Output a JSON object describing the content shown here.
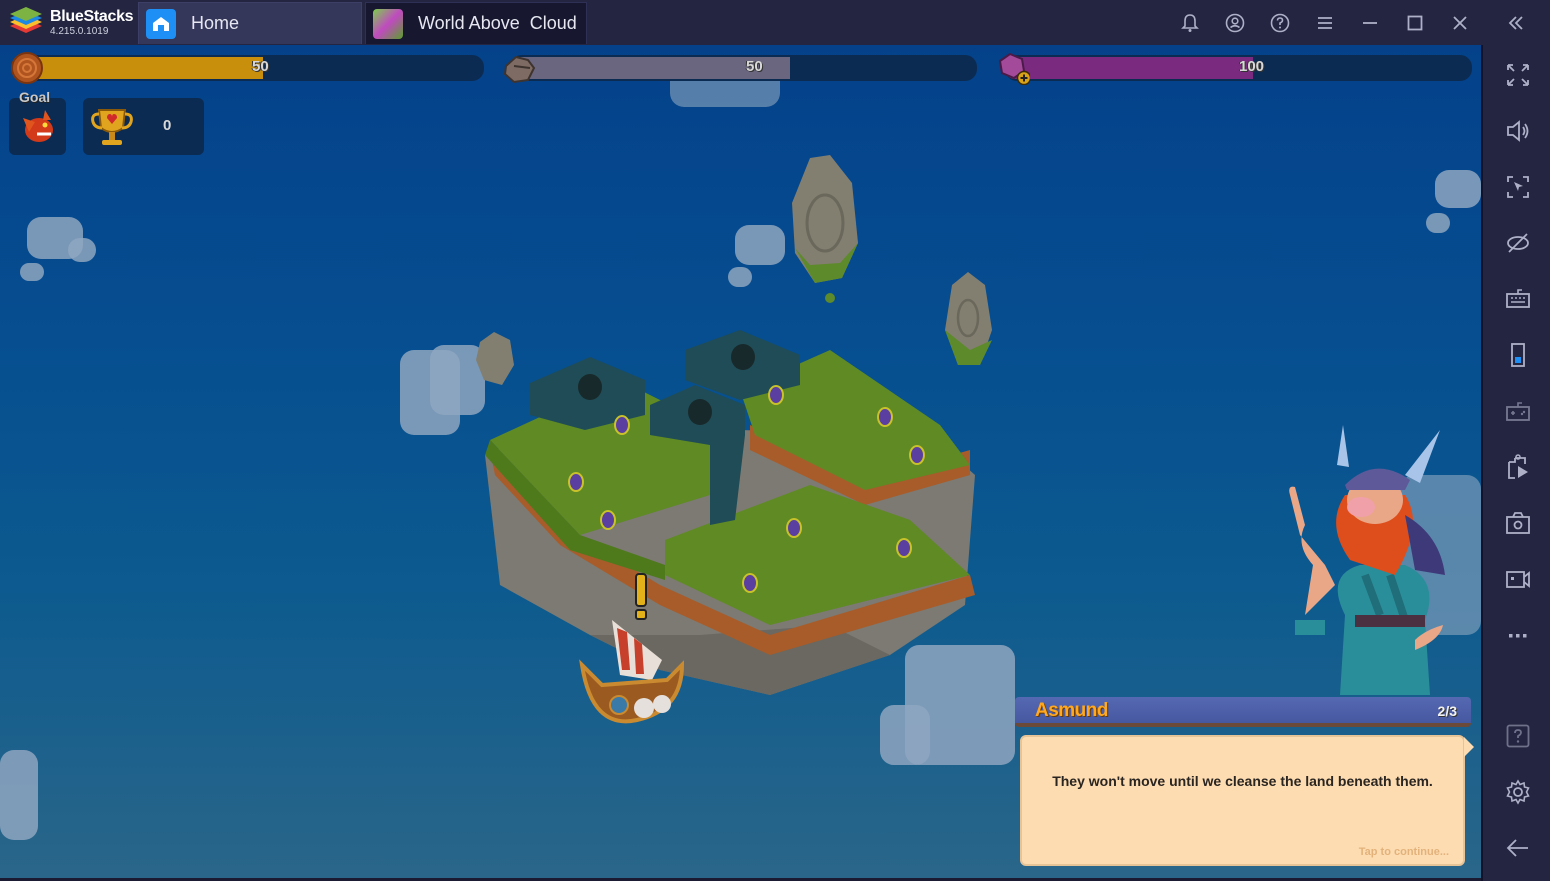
{
  "app": {
    "name": "BlueStacks",
    "version": "4.215.0.1019"
  },
  "tabs": [
    {
      "label": "Home",
      "icon": "home-icon",
      "active": false
    },
    {
      "label": "World Above  Cloud",
      "icon": "game-icon",
      "active": true
    }
  ],
  "titlebar_buttons": [
    {
      "name": "notifications",
      "icon": "bell-icon"
    },
    {
      "name": "account",
      "icon": "account-icon"
    },
    {
      "name": "help",
      "icon": "help-icon"
    },
    {
      "name": "menu",
      "icon": "hamburger-icon"
    },
    {
      "name": "minimize",
      "icon": "minimize-icon"
    },
    {
      "name": "maximize",
      "icon": "maximize-icon"
    },
    {
      "name": "close",
      "icon": "close-icon"
    },
    {
      "name": "collapse-sidebar",
      "icon": "double-chevron-left-icon"
    }
  ],
  "sidebar": [
    {
      "name": "fullscreen",
      "icon": "fullscreen-icon"
    },
    {
      "name": "volume",
      "icon": "volume-icon"
    },
    {
      "name": "lock-cursor",
      "icon": "cursor-lock-icon"
    },
    {
      "name": "hide-overlay",
      "icon": "eye-off-icon"
    },
    {
      "name": "keyboard-controls",
      "icon": "keyboard-icon"
    },
    {
      "name": "rotate",
      "icon": "phone-portrait-icon"
    },
    {
      "name": "gamepad",
      "icon": "gamepad-icon"
    },
    {
      "name": "install-apk",
      "icon": "apk-install-icon"
    },
    {
      "name": "screenshot",
      "icon": "camera-icon"
    },
    {
      "name": "record",
      "icon": "video-record-icon"
    },
    {
      "name": "more",
      "icon": "more-icon"
    },
    {
      "name": "help",
      "icon": "help-square-icon"
    },
    {
      "name": "settings",
      "icon": "gear-icon"
    },
    {
      "name": "back",
      "icon": "arrow-left-icon"
    }
  ],
  "game": {
    "resources": [
      {
        "name": "wood",
        "icon": "wood-icon",
        "value": "50",
        "fill_fraction": 0.53,
        "color": "#c78f0b"
      },
      {
        "name": "stone",
        "icon": "stone-icon",
        "value": "50",
        "fill_fraction": 0.6,
        "color": "#6b6680"
      },
      {
        "name": "gems",
        "icon": "gem-icon",
        "value": "100",
        "fill_fraction": 0.53,
        "color": "#7a2b80"
      }
    ],
    "goal_label": "Goal",
    "goal_icon": "dragon-icon",
    "trophy_icon": "trophy-icon",
    "trophy_count": "0",
    "dialogue": {
      "speaker": "Asmund",
      "page": "2/3",
      "text": "They won't move until we cleanse the land beneath them.",
      "continue_hint": "Tap to continue..."
    }
  }
}
